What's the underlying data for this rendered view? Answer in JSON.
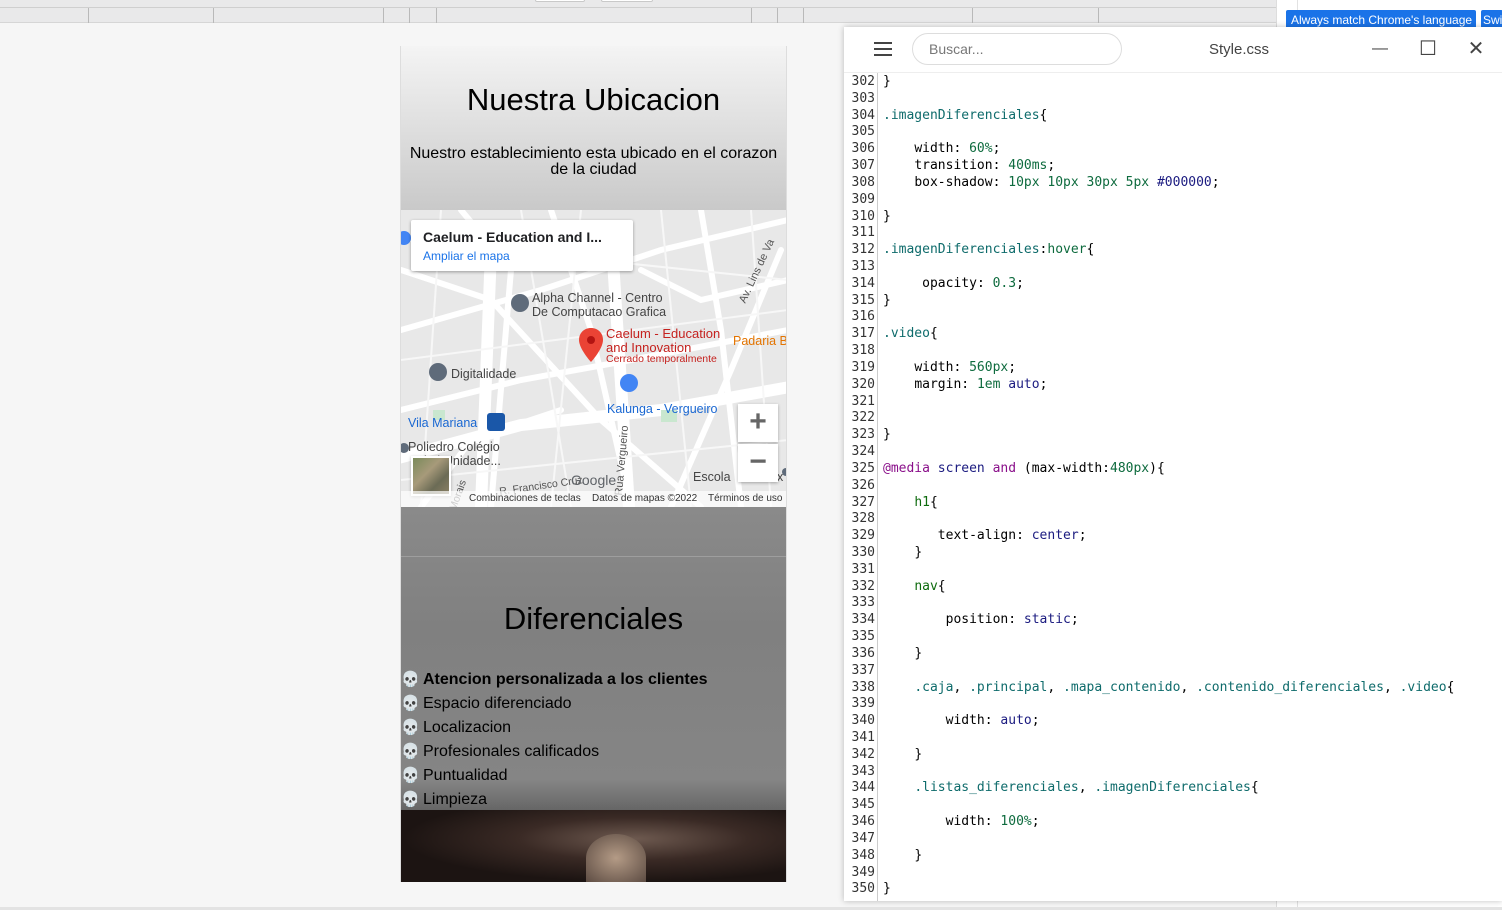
{
  "translate": {
    "btn1": "Always match Chrome's language",
    "btn2": "Swi"
  },
  "preview": {
    "ubicacion_title": "Nuestra Ubicacion",
    "ubicacion_text": "Nuestro establecimiento esta ubicado en el corazon de la ciudad",
    "map": {
      "card_title": "Caelum - Education and I...",
      "card_link": "Ampliar el mapa",
      "labels": {
        "alpha1": "Alpha Channel - Centro",
        "alpha2": "De Computacao Grafica",
        "caelum1": "Caelum - Education",
        "caelum2": "and Innovation",
        "caelum3": "Cerrado temporalmente",
        "padaria": "Padaria B",
        "digitalidade": "Digitalidade",
        "kalunga": "Kalunga - Vergueiro",
        "vila": "Vila Mariana",
        "poliedro1": "Poliedro Colégio",
        "poliedro2": "ulo | Unidade...",
        "avlins": "Av. Lins de Va",
        "ruaverg": "Rua Vergueiro",
        "francisco": "R. Francisco Cruz",
        "morais": "Morais",
        "escola": "Escola",
        "google": "Google",
        "x": "x"
      },
      "zoom_in": "+",
      "zoom_out": "−",
      "footer": {
        "keys": "Combinaciones de teclas",
        "data": "Datos de mapas ©2022",
        "terms": "Términos de uso"
      }
    },
    "diferenciales_title": "Diferenciales",
    "diferenciales": [
      {
        "text": "Atencion personalizada a los clientes",
        "bold": true
      },
      {
        "text": "Espacio diferenciado"
      },
      {
        "text": "Localizacion"
      },
      {
        "text": "Profesionales calificados"
      },
      {
        "text": "Puntualidad"
      },
      {
        "text": "Limpieza"
      }
    ],
    "bullet": "💀"
  },
  "editor": {
    "search_placeholder": "Buscar...",
    "filename": "Style.css",
    "min_icon": "—",
    "max_icon": "☐",
    "close_icon": "✕",
    "lines": [
      {
        "n": "302",
        "html": "<span class='br'>}</span>"
      },
      {
        "n": "303",
        "html": ""
      },
      {
        "n": "304",
        "html": "<span class='sel'>.imagenDiferenciales</span><span class='br'>{</span>"
      },
      {
        "n": "305",
        "html": ""
      },
      {
        "n": "306",
        "html": "    <span class='prop'>width</span>: <span class='val'>60%</span>;"
      },
      {
        "n": "307",
        "html": "    <span class='prop'>transition</span>: <span class='val'>400ms</span>;"
      },
      {
        "n": "308",
        "html": "    <span class='prop'>box-shadow</span>: <span class='val'>10px 10px 30px 5px</span> <span class='kw'>#000000</span>;"
      },
      {
        "n": "309",
        "html": ""
      },
      {
        "n": "310",
        "html": "<span class='br'>}</span>"
      },
      {
        "n": "311",
        "html": ""
      },
      {
        "n": "312",
        "html": "<span class='sel'>.imagenDiferenciales</span>:<span class='val'>hover</span><span class='br'>{</span>"
      },
      {
        "n": "313",
        "html": ""
      },
      {
        "n": "314",
        "html": "     <span class='prop'>opacity</span>: <span class='val'>0.3</span>;"
      },
      {
        "n": "315",
        "html": "<span class='br'>}</span>"
      },
      {
        "n": "316",
        "html": ""
      },
      {
        "n": "317",
        "html": "<span class='sel'>.video</span><span class='br'>{</span>"
      },
      {
        "n": "318",
        "html": ""
      },
      {
        "n": "319",
        "html": "    <span class='prop'>width</span>: <span class='val'>560px</span>;"
      },
      {
        "n": "320",
        "html": "    <span class='prop'>margin</span>: <span class='val'>1em</span> <span class='kw'>auto</span>;"
      },
      {
        "n": "321",
        "html": ""
      },
      {
        "n": "322",
        "html": ""
      },
      {
        "n": "323",
        "html": "<span class='br'>}</span>"
      },
      {
        "n": "324",
        "html": ""
      },
      {
        "n": "325",
        "html": "<span class='at'>@media</span> <span class='kw'>screen</span> <span class='at'>and</span> (max-width:<span class='val'>480px</span>)<span class='br'>{</span>"
      },
      {
        "n": "326",
        "html": ""
      },
      {
        "n": "327",
        "html": "    <span class='tag'>h1</span><span class='br'>{</span>"
      },
      {
        "n": "328",
        "html": ""
      },
      {
        "n": "329",
        "html": "       <span class='prop'>text-align</span>: <span class='kw'>center</span>;"
      },
      {
        "n": "330",
        "html": "    <span class='br'>}</span>"
      },
      {
        "n": "331",
        "html": ""
      },
      {
        "n": "332",
        "html": "    <span class='tag'>nav</span><span class='br'>{</span>"
      },
      {
        "n": "333",
        "html": ""
      },
      {
        "n": "334",
        "html": "        <span class='prop'>position</span>: <span class='kw'>static</span>;"
      },
      {
        "n": "335",
        "html": ""
      },
      {
        "n": "336",
        "html": "    <span class='br'>}</span>"
      },
      {
        "n": "337",
        "html": ""
      },
      {
        "n": "338",
        "html": "    <span class='sel'>.caja</span>, <span class='sel'>.principal</span>, <span class='sel'>.mapa_contenido</span>, <span class='sel'>.contenido_diferenciales</span>, <span class='sel'>.video</span><span class='br'>{</span>"
      },
      {
        "n": "339",
        "html": ""
      },
      {
        "n": "340",
        "html": "        <span class='prop'>width</span>: <span class='kw'>auto</span>;"
      },
      {
        "n": "341",
        "html": ""
      },
      {
        "n": "342",
        "html": "    <span class='br'>}</span>"
      },
      {
        "n": "343",
        "html": ""
      },
      {
        "n": "344",
        "html": "    <span class='sel'>.listas_diferenciales</span>, <span class='sel'>.imagenDiferenciales</span><span class='br'>{</span>"
      },
      {
        "n": "345",
        "html": ""
      },
      {
        "n": "346",
        "html": "        <span class='prop'>width</span>: <span class='val'>100%</span>;"
      },
      {
        "n": "347",
        "html": ""
      },
      {
        "n": "348",
        "html": "    <span class='br'>}</span>"
      },
      {
        "n": "349",
        "html": ""
      },
      {
        "n": "350",
        "html": "<span class='br'>}</span>"
      }
    ]
  }
}
